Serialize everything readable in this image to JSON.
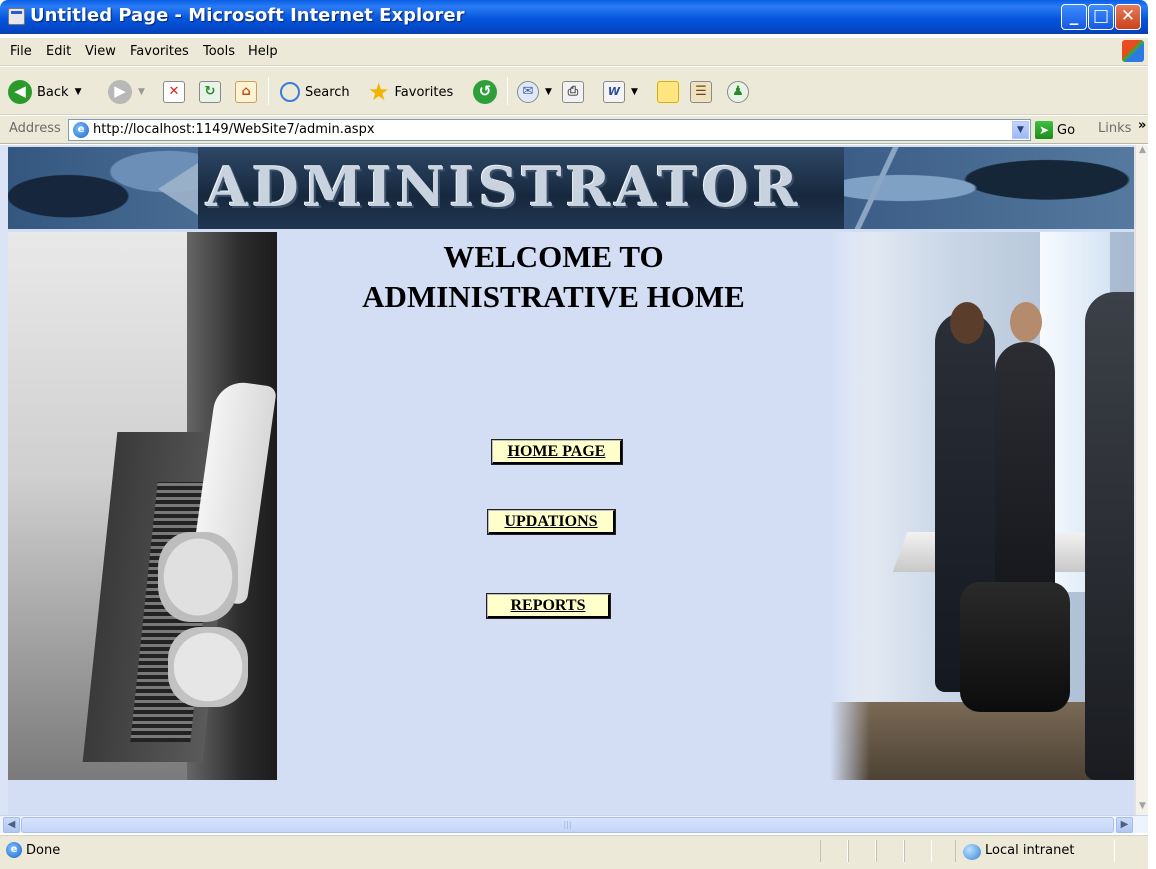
{
  "window": {
    "title": "Untitled Page - Microsoft Internet Explorer",
    "controls": {
      "minimize": "_",
      "maximize": "□",
      "close": "✕"
    }
  },
  "menu": [
    "File",
    "Edit",
    "View",
    "Favorites",
    "Tools",
    "Help"
  ],
  "toolbar": {
    "back_label": "Back",
    "search_label": "Search",
    "favorites_label": "Favorites"
  },
  "address": {
    "label": "Address",
    "url": "http://localhost:1149/WebSite7/admin.aspx",
    "go_label": "Go",
    "links_label": "Links"
  },
  "page": {
    "banner_text": "ADMINISTRATOR",
    "welcome_line1": "WELCOME TO",
    "welcome_line2": "ADMINISTRATIVE HOME",
    "buttons": {
      "home": "HOME PAGE",
      "updations": "UPDATIONS",
      "reports": "REPORTS"
    }
  },
  "status": {
    "text": "Done",
    "zone": "Local intranet"
  },
  "colors": {
    "titlebar": "#0556dd",
    "content_bg": "#d3def5",
    "button_bg": "#ffffcc"
  }
}
